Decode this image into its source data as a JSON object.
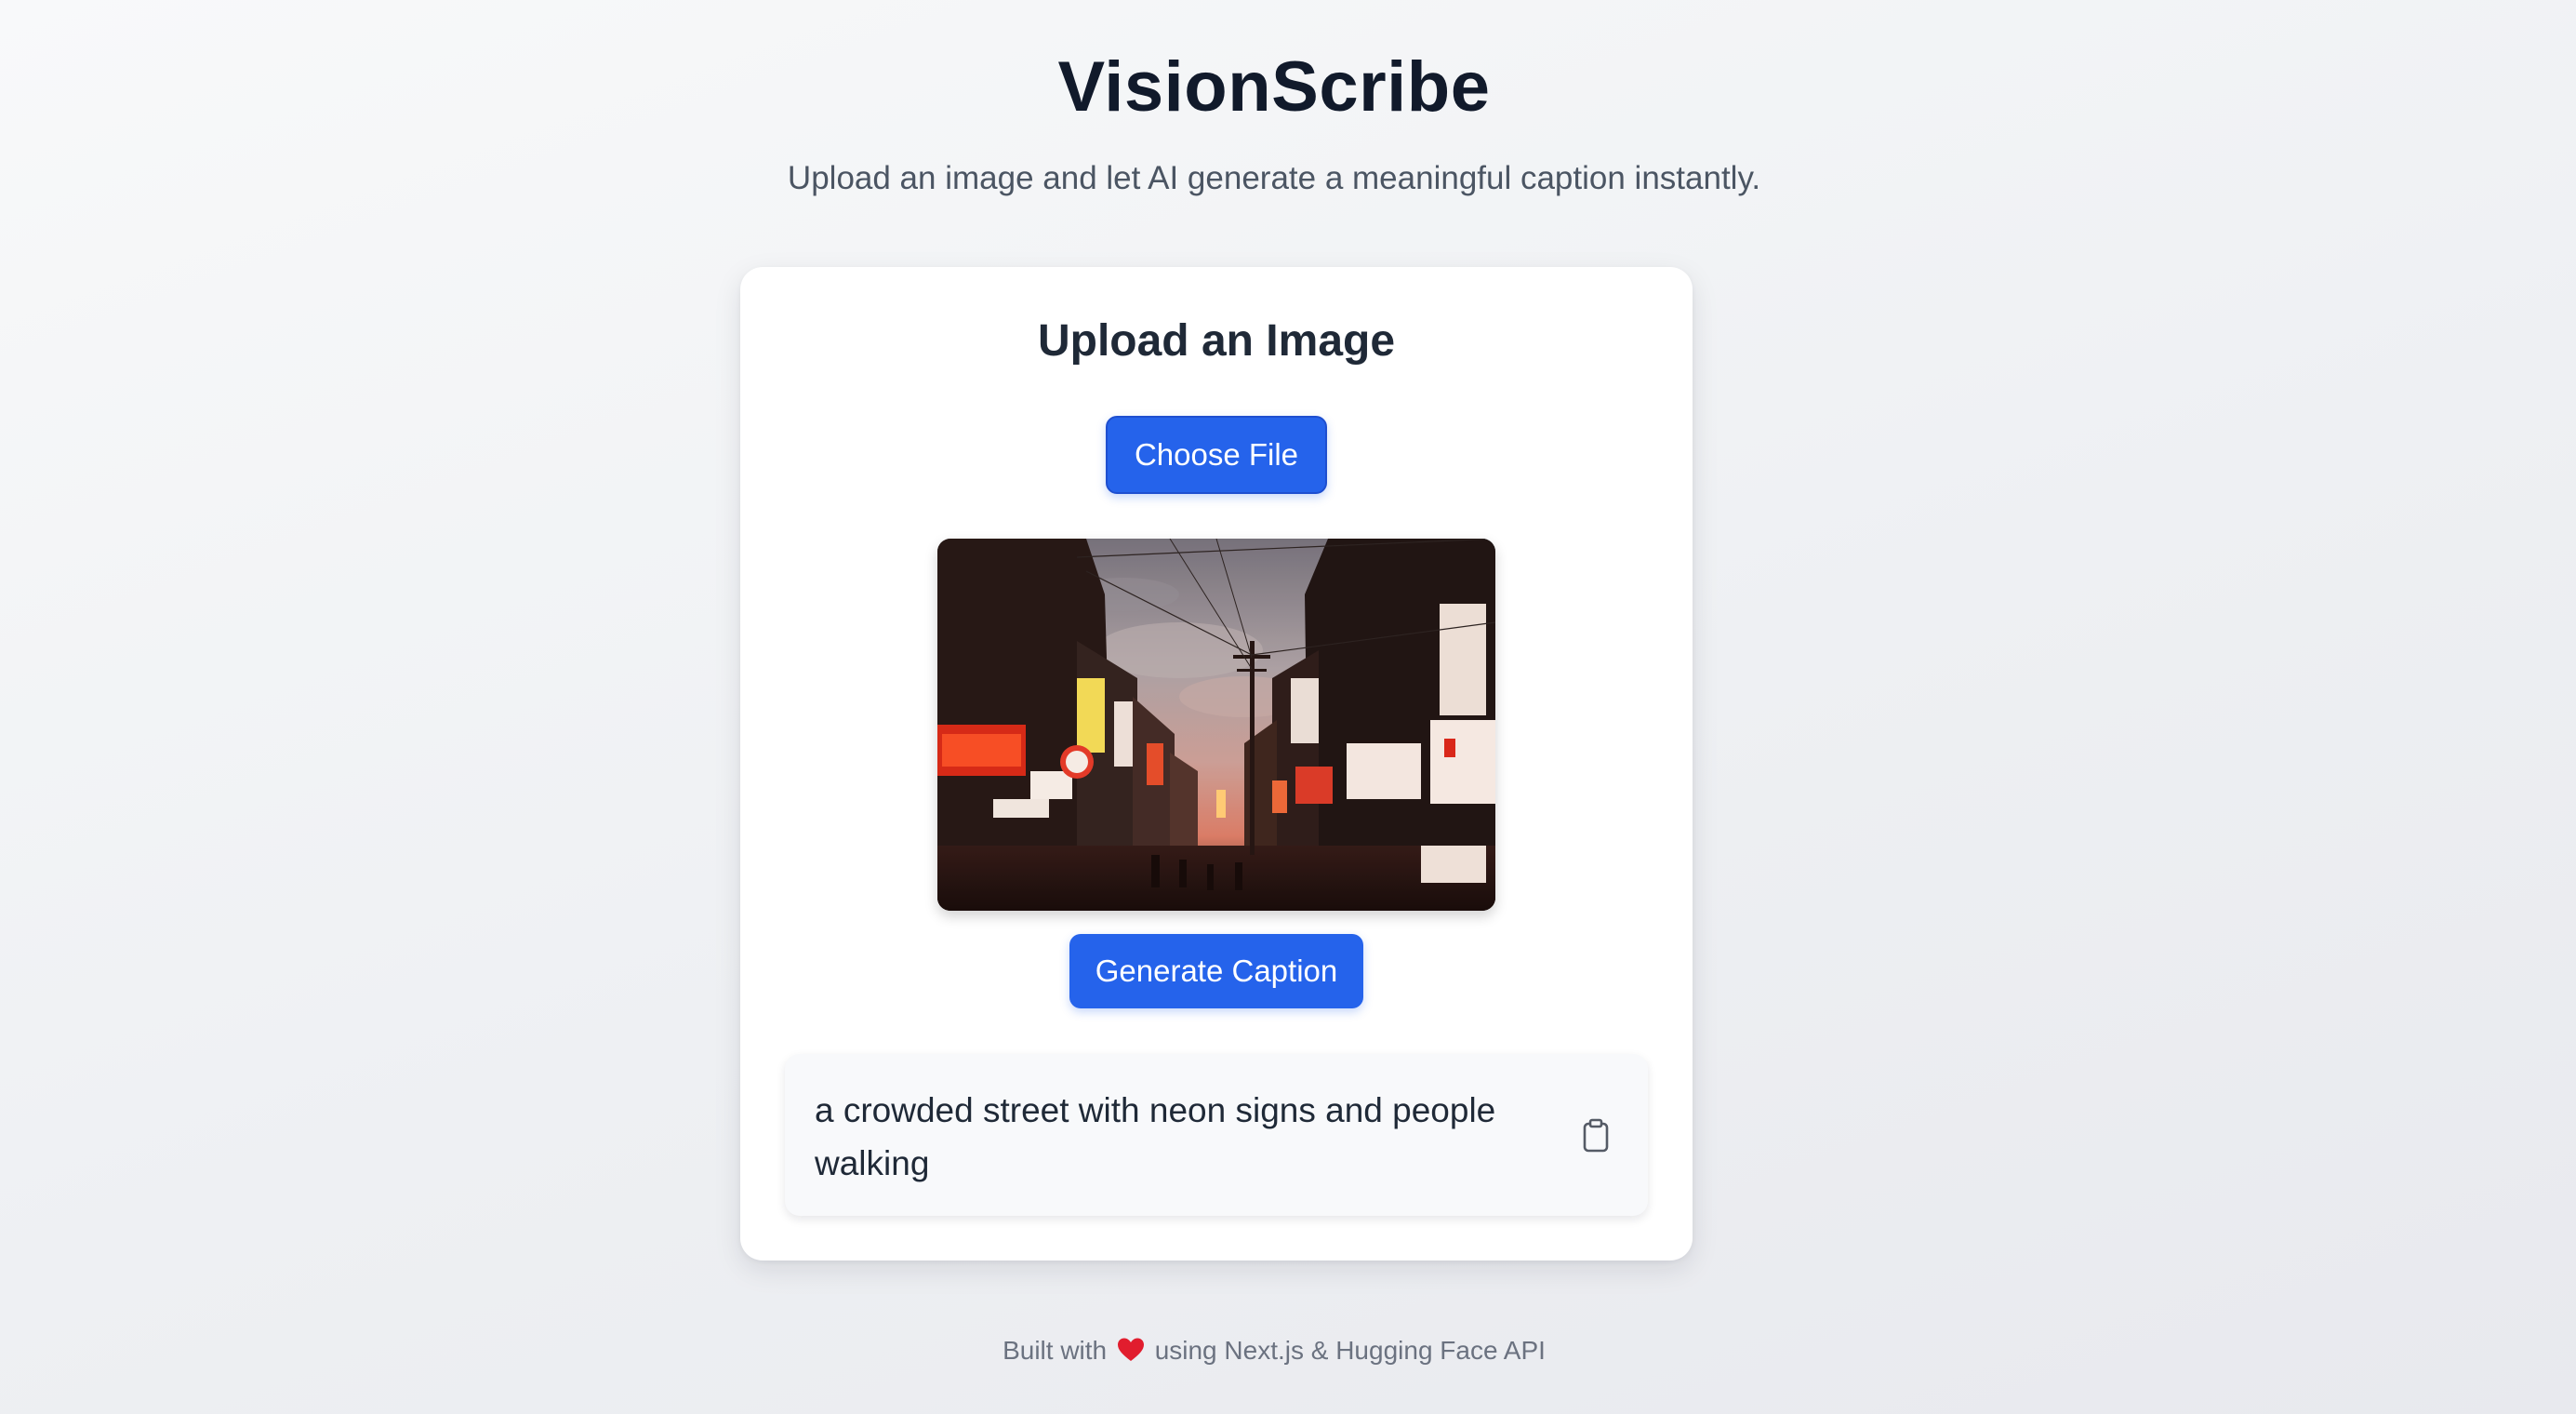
{
  "header": {
    "title": "VisionScribe",
    "subtitle": "Upload an image and let AI generate a meaningful caption instantly."
  },
  "uploader": {
    "title": "Upload an Image",
    "choose_file_label": "Choose File",
    "preview_alt": "Uploaded image preview: city street with neon signs at dusk",
    "generate_label": "Generate Caption"
  },
  "result": {
    "caption": "a crowded street with neon signs and people walking",
    "copy_icon": "clipboard-icon"
  },
  "footer": {
    "prefix": "Built with",
    "heart_icon": "heart-icon",
    "suffix": "using Next.js & Hugging Face API"
  },
  "colors": {
    "accent": "#2563eb",
    "title": "#111a2b",
    "subtitle": "#4b5563",
    "heart": "#e11d2e"
  }
}
